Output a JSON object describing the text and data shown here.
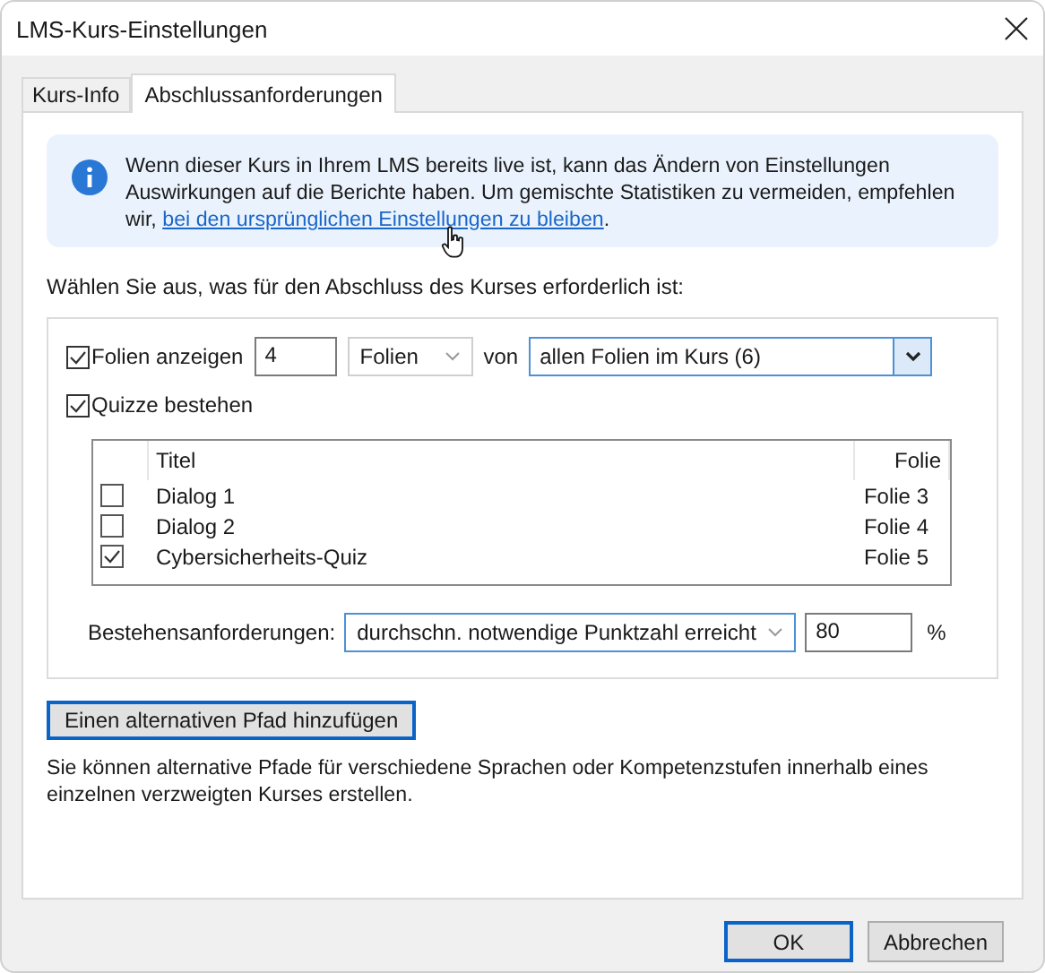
{
  "window": {
    "title": "LMS-Kurs-Einstellungen"
  },
  "tabs": [
    {
      "label": "Kurs-Info",
      "selected": false
    },
    {
      "label": "Abschlussanforderungen",
      "selected": true
    }
  ],
  "info": {
    "text": "Wenn dieser Kurs in Ihrem LMS bereits live ist, kann das Ändern von Einstellungen Auswirkungen auf die Berichte haben. Um gemischte Statistiken zu vermeiden, empfehlen wir, ",
    "link": "bei den ursprünglichen Einstellungen zu bleiben",
    "after": "."
  },
  "prompt": "Wählen Sie aus, was für den Abschluss des Kurses erforderlich ist:",
  "slides": {
    "checked": true,
    "label": "Folien anzeigen",
    "count": "4",
    "unit": "Folien",
    "of_label": "von",
    "scope": "allen Folien im Kurs (6)"
  },
  "quizzes": {
    "checked": true,
    "label": "Quizze bestehen",
    "columns": [
      "Titel",
      "Folie"
    ],
    "rows": [
      {
        "checked": false,
        "title": "Dialog 1",
        "slide": "Folie 3"
      },
      {
        "checked": false,
        "title": "Dialog 2",
        "slide": "Folie 4"
      },
      {
        "checked": true,
        "title": "Cybersicherheits-Quiz",
        "slide": "Folie 5"
      }
    ]
  },
  "pass": {
    "label": "Bestehensanforderungen:",
    "requirement": "durchschn. notwendige Punktzahl erreicht",
    "score": "80",
    "unit": "%"
  },
  "alt_path": {
    "button": "Einen alternativen Pfad hinzufügen",
    "hint": "Sie können alternative Pfade für verschiedene Sprachen oder Kompetenzstufen innerhalb eines einzelnen verzweigten Kurses erstellen."
  },
  "buttons": [
    {
      "label": "OK",
      "kind": "default"
    },
    {
      "label": "Abbrechen",
      "kind": "normal"
    }
  ]
}
